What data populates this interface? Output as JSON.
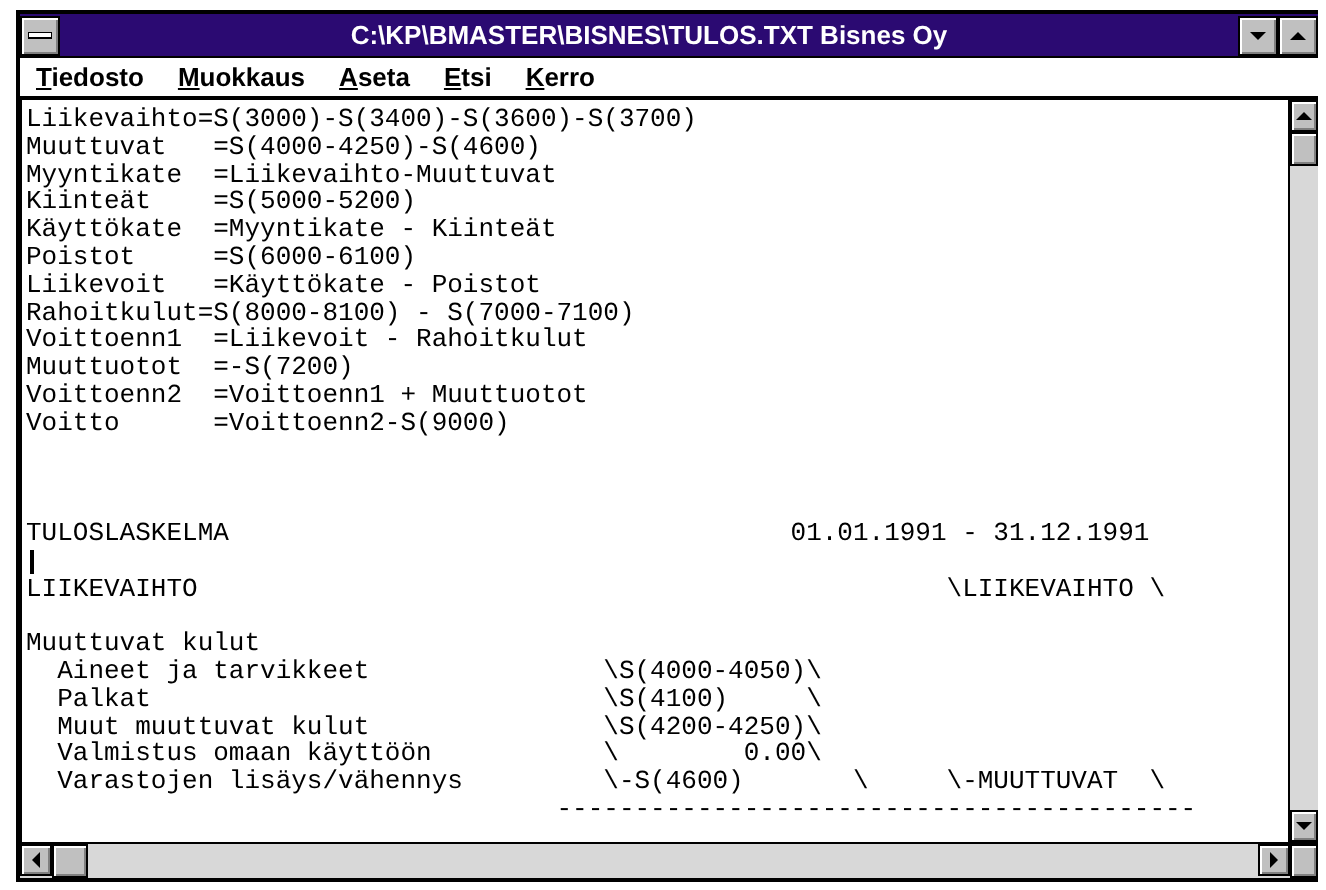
{
  "window": {
    "title": "C:\\KP\\BMASTER\\BISNES\\TULOS.TXT Bisnes Oy"
  },
  "menu": [
    {
      "label": "Tiedosto"
    },
    {
      "label": "Muokkaus"
    },
    {
      "label": "Aseta"
    },
    {
      "label": "Etsi"
    },
    {
      "label": "Kerro"
    }
  ],
  "document": {
    "lines": [
      {
        "kind": "text",
        "text": "Liikevaihto=S(3000)-S(3400)-S(3600)-S(3700)"
      },
      {
        "kind": "text",
        "text": "Muuttuvat   =S(4000-4250)-S(4600)"
      },
      {
        "kind": "text",
        "text": "Myyntikate  =Liikevaihto-Muuttuvat"
      },
      {
        "kind": "text",
        "text": "Kiinteät    =S(5000-5200)"
      },
      {
        "kind": "text",
        "text": "Käyttökate  =Myyntikate - Kiinteät"
      },
      {
        "kind": "text",
        "text": "Poistot     =S(6000-6100)"
      },
      {
        "kind": "text",
        "text": "Liikevoit   =Käyttökate - Poistot"
      },
      {
        "kind": "text",
        "text": "Rahoitkulut=S(8000-8100) - S(7000-7100)"
      },
      {
        "kind": "text",
        "text": "Voittoenn1  =Liikevoit - Rahoitkulut"
      },
      {
        "kind": "text",
        "text": "Muuttuotot  =-S(7200)"
      },
      {
        "kind": "text",
        "text": "Voittoenn2  =Voittoenn1 + Muuttuotot"
      },
      {
        "kind": "text",
        "text": "Voitto      =Voittoenn2-S(9000)"
      },
      {
        "kind": "blank"
      },
      {
        "kind": "blank"
      },
      {
        "kind": "blank"
      },
      {
        "kind": "text",
        "text": "TULOSLASKELMA                                    01.01.1991 - 31.12.1991"
      },
      {
        "kind": "cursor"
      },
      {
        "kind": "text",
        "text": "LIIKEVAIHTO                                                \\LIIKEVAIHTO \\"
      },
      {
        "kind": "blank"
      },
      {
        "kind": "text",
        "text": "Muuttuvat kulut"
      },
      {
        "kind": "text",
        "text": "  Aineet ja tarvikkeet               \\S(4000-4050)\\"
      },
      {
        "kind": "text",
        "text": "  Palkat                             \\S(4100)     \\"
      },
      {
        "kind": "text",
        "text": "  Muut muuttuvat kulut               \\S(4200-4250)\\"
      },
      {
        "kind": "text",
        "text": "  Valmistus omaan käyttöön           \\        0.00\\"
      },
      {
        "kind": "text",
        "text": "  Varastojen lisäys/vähennys         \\-S(4600)       \\     \\-MUUTTUVAT  \\"
      },
      {
        "kind": "text",
        "text": "                                  -----------------------------------------"
      }
    ]
  }
}
